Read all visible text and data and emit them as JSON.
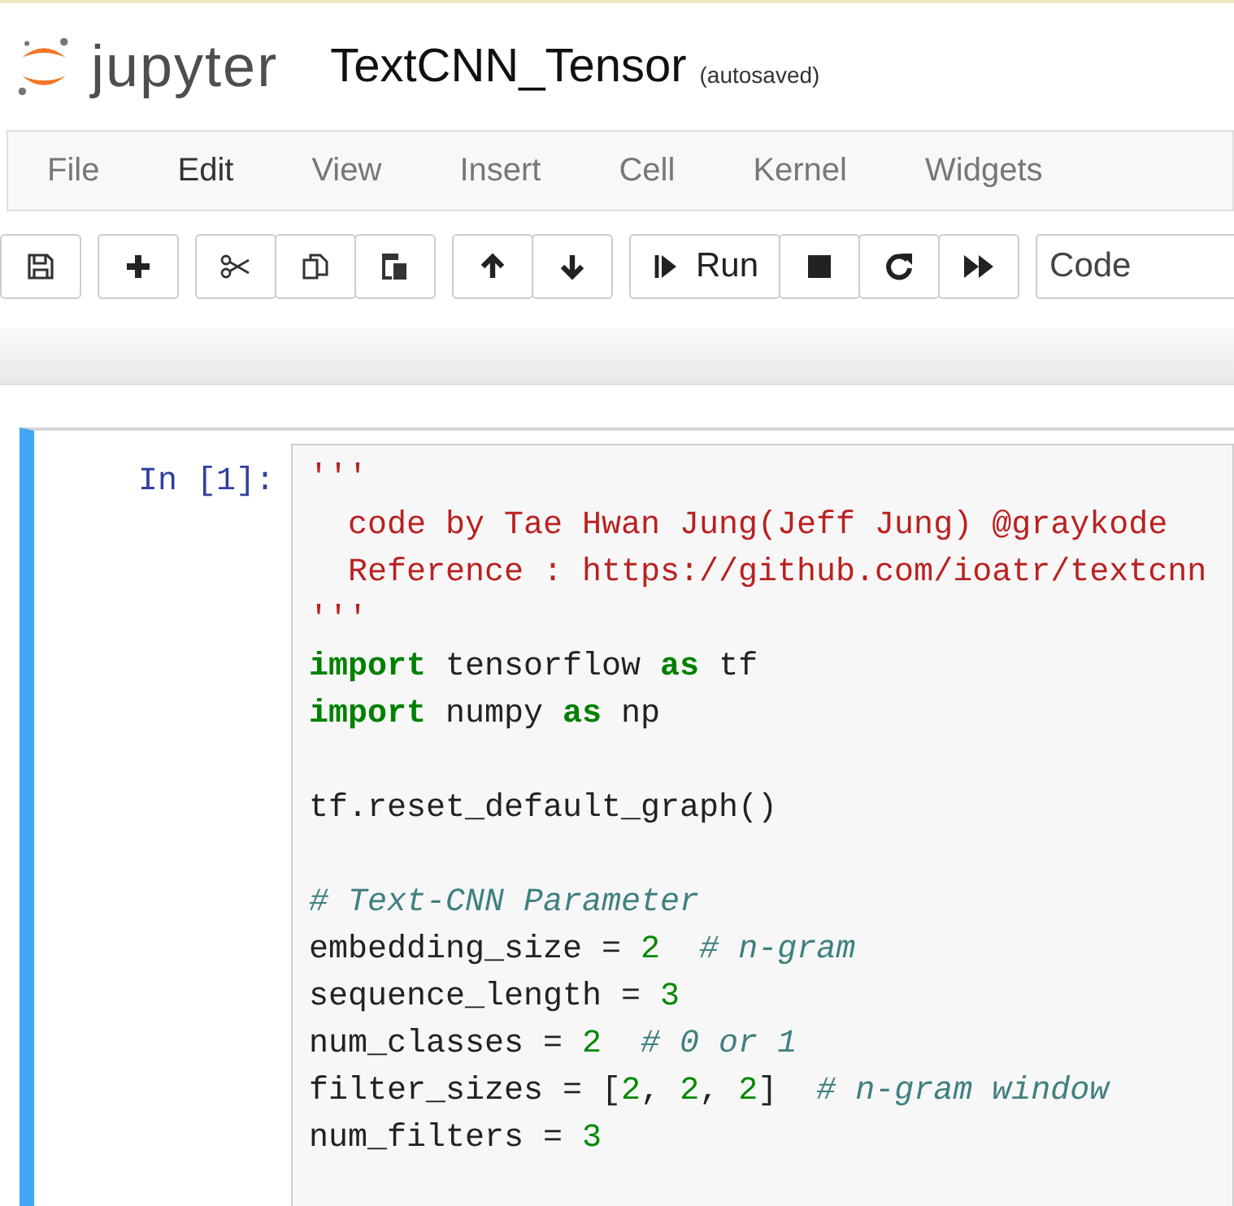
{
  "header": {
    "logo_text": "jupyter",
    "notebook_name": "TextCNN_Tensor",
    "save_status": "(autosaved)"
  },
  "menu": [
    {
      "label": "File",
      "selected": false
    },
    {
      "label": "Edit",
      "selected": true
    },
    {
      "label": "View",
      "selected": false
    },
    {
      "label": "Insert",
      "selected": false
    },
    {
      "label": "Cell",
      "selected": false
    },
    {
      "label": "Kernel",
      "selected": false
    },
    {
      "label": "Widgets",
      "selected": false
    }
  ],
  "toolbar": [
    [
      {
        "kind": "save"
      }
    ],
    [
      {
        "kind": "plus"
      }
    ],
    [
      {
        "kind": "cut"
      },
      {
        "kind": "copy"
      },
      {
        "kind": "paste"
      }
    ],
    [
      {
        "kind": "up"
      },
      {
        "kind": "down"
      }
    ],
    [
      {
        "kind": "run",
        "label": "Run"
      },
      {
        "kind": "stop"
      },
      {
        "kind": "restart"
      },
      {
        "kind": "fastforward"
      }
    ]
  ],
  "cell_type_select": {
    "value": "Code"
  },
  "cell": {
    "prompt": "In [1]:",
    "selected": true,
    "lines": [
      {
        "kind": "code",
        "tokens": [
          {
            "kind": "string",
            "text": "'''"
          }
        ]
      },
      {
        "kind": "code",
        "tokens": [
          {
            "kind": "string",
            "text": "  code by Tae Hwan Jung(Jeff Jung) @graykode"
          }
        ]
      },
      {
        "kind": "code",
        "tokens": [
          {
            "kind": "string",
            "text": "  Reference : https://github.com/ioatr/textcnn"
          }
        ]
      },
      {
        "kind": "code",
        "tokens": [
          {
            "kind": "string",
            "text": "'''"
          }
        ]
      },
      {
        "kind": "code",
        "tokens": [
          {
            "kind": "keyword",
            "text": "import"
          },
          {
            "kind": "plain",
            "text": " tensorflow "
          },
          {
            "kind": "keyword",
            "text": "as"
          },
          {
            "kind": "plain",
            "text": " tf"
          }
        ]
      },
      {
        "kind": "code",
        "tokens": [
          {
            "kind": "keyword",
            "text": "import"
          },
          {
            "kind": "plain",
            "text": " numpy "
          },
          {
            "kind": "keyword",
            "text": "as"
          },
          {
            "kind": "plain",
            "text": " np"
          }
        ]
      },
      {
        "kind": "blank"
      },
      {
        "kind": "code",
        "tokens": [
          {
            "kind": "plain",
            "text": "tf.reset_default_graph()"
          }
        ]
      },
      {
        "kind": "blank"
      },
      {
        "kind": "code",
        "tokens": [
          {
            "kind": "comment",
            "text": "# Text-CNN Parameter"
          }
        ]
      },
      {
        "kind": "code",
        "tokens": [
          {
            "kind": "plain",
            "text": "embedding_size = "
          },
          {
            "kind": "number",
            "text": "2"
          },
          {
            "kind": "comment",
            "text": "  # n-gram"
          }
        ]
      },
      {
        "kind": "code",
        "tokens": [
          {
            "kind": "plain",
            "text": "sequence_length = "
          },
          {
            "kind": "number",
            "text": "3"
          }
        ]
      },
      {
        "kind": "code",
        "tokens": [
          {
            "kind": "plain",
            "text": "num_classes = "
          },
          {
            "kind": "number",
            "text": "2"
          },
          {
            "kind": "comment",
            "text": "  # 0 or 1"
          }
        ]
      },
      {
        "kind": "code",
        "tokens": [
          {
            "kind": "plain",
            "text": "filter_sizes = ["
          },
          {
            "kind": "number",
            "text": "2"
          },
          {
            "kind": "plain",
            "text": ", "
          },
          {
            "kind": "number",
            "text": "2"
          },
          {
            "kind": "plain",
            "text": ", "
          },
          {
            "kind": "number",
            "text": "2"
          },
          {
            "kind": "plain",
            "text": "]  "
          },
          {
            "kind": "comment",
            "text": "# n-gram window"
          }
        ]
      },
      {
        "kind": "code",
        "tokens": [
          {
            "kind": "plain",
            "text": "num_filters = "
          },
          {
            "kind": "number",
            "text": "3"
          }
        ]
      }
    ]
  }
}
